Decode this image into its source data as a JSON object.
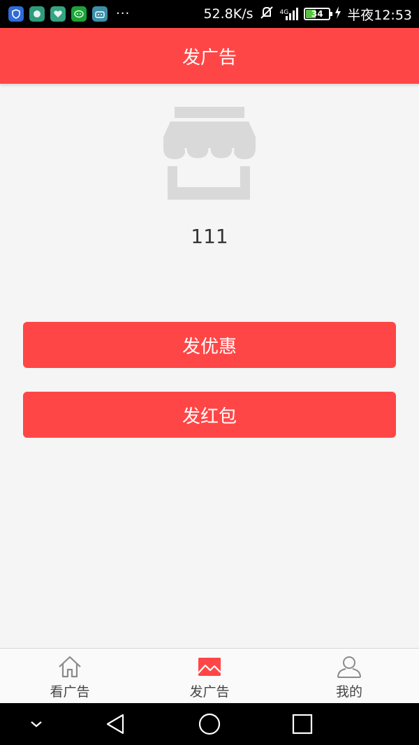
{
  "status_bar": {
    "speed": "52.8K/s",
    "network": "4G",
    "battery": "34",
    "time": "半夜12:53",
    "overflow": "···",
    "icons": [
      "shield-app-icon",
      "security-app-icon",
      "heart-app-icon",
      "wechat-app-icon",
      "android-app-icon",
      "mute-icon",
      "signal-icon",
      "battery-icon",
      "charging-icon"
    ]
  },
  "app_bar": {
    "title": "发广告"
  },
  "shop": {
    "name": "111",
    "icon": "store-icon"
  },
  "actions": {
    "discount_label": "发优惠",
    "red_packet_label": "发红包"
  },
  "bottom_nav": {
    "items": [
      {
        "label": "看广告",
        "icon": "home-icon",
        "active": false
      },
      {
        "label": "发广告",
        "icon": "picture-icon",
        "active": true
      },
      {
        "label": "我的",
        "icon": "user-icon",
        "active": false
      }
    ]
  },
  "colors": {
    "primary": "#ff4646",
    "background": "#f5f5f5",
    "placeholder_icon": "#d9d9d9"
  }
}
